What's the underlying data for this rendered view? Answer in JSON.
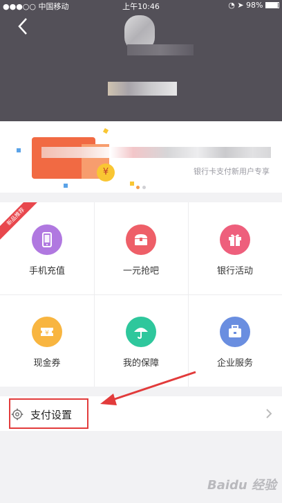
{
  "status_bar": {
    "carrier": "●●●○○ 中国移动",
    "time": "上午10:46",
    "battery": "98%"
  },
  "header": {
    "back_icon": "chevron-left-icon"
  },
  "banner": {
    "caption": "银行卡支付新用户专享",
    "coin_symbol": "¥"
  },
  "badge": {
    "text": "新品推荐"
  },
  "grid": {
    "items": [
      {
        "label": "手机充值",
        "icon": "phone-icon",
        "color": "#b078e0"
      },
      {
        "label": "一元抢吧",
        "icon": "treasure-icon",
        "color": "#ee5f68"
      },
      {
        "label": "银行活动",
        "icon": "gift-icon",
        "color": "#ee5f7c"
      },
      {
        "label": "现金券",
        "icon": "coupon-icon",
        "color": "#f8b540"
      },
      {
        "label": "我的保障",
        "icon": "umbrella-icon",
        "color": "#2ec79c"
      },
      {
        "label": "企业服务",
        "icon": "briefcase-icon",
        "color": "#6a8ee0"
      }
    ]
  },
  "settings": {
    "label": "支付设置",
    "icon": "gear-icon"
  },
  "watermark": {
    "text": "Baidu 经验"
  }
}
